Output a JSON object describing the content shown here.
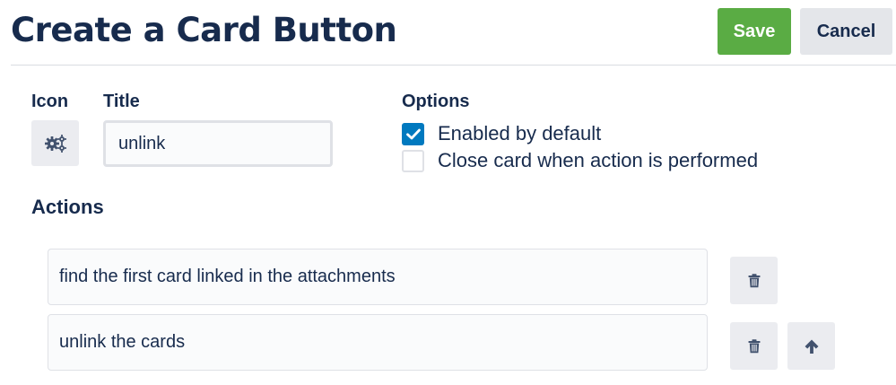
{
  "header": {
    "title": "Create a Card Button",
    "save_label": "Save",
    "cancel_label": "Cancel"
  },
  "form": {
    "icon_label": "Icon",
    "icon_name": "gears-icon",
    "title_label": "Title",
    "title_value": "unlink",
    "options_label": "Options",
    "options": [
      {
        "label": "Enabled by default",
        "checked": true
      },
      {
        "label": "Close card when action is performed",
        "checked": false
      }
    ]
  },
  "actions": {
    "label": "Actions",
    "items": [
      {
        "text": "find the first card linked in the attachments",
        "buttons": [
          "trash-icon"
        ]
      },
      {
        "text": "unlink the cards",
        "buttons": [
          "trash-icon",
          "arrow-up-icon"
        ]
      }
    ]
  },
  "colors": {
    "save": "#5aac44",
    "checkbox_checked": "#0079bf",
    "text": "#172b4d"
  }
}
